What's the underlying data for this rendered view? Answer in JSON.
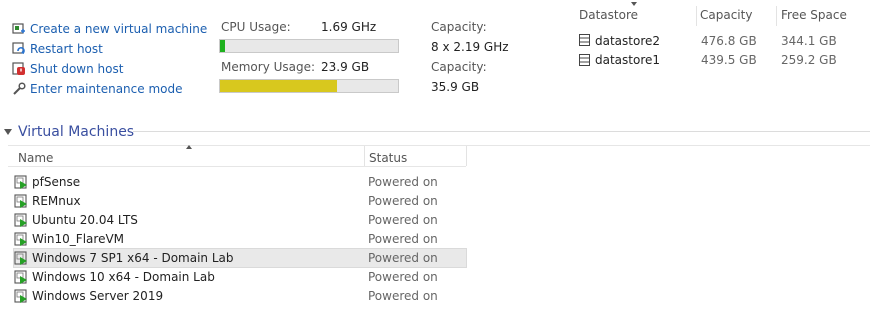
{
  "actions": [
    {
      "label": "Create a new virtual machine",
      "icon": "new-vm-icon"
    },
    {
      "label": "Restart host",
      "icon": "restart-icon"
    },
    {
      "label": "Shut down host",
      "icon": "shutdown-icon"
    },
    {
      "label": "Enter maintenance mode",
      "icon": "wrench-icon"
    }
  ],
  "usage": {
    "cpu_label": "CPU Usage:",
    "cpu_value": "1.69 GHz",
    "cpu_fraction": 0.03,
    "cpu_capacity_label": "Capacity:",
    "cpu_capacity_value": "8 x 2.19 GHz",
    "mem_label": "Memory Usage:",
    "mem_value": "23.9 GB",
    "mem_fraction": 0.66,
    "mem_capacity_label": "Capacity:",
    "mem_capacity_value": "35.9 GB",
    "cpu_color": "#1db11d",
    "mem_color": "#d8c81e"
  },
  "datastores": {
    "headers": [
      "Datastore",
      "Capacity",
      "Free Space"
    ],
    "rows": [
      {
        "name": "datastore2",
        "capacity": "476.8 GB",
        "free": "344.1 GB"
      },
      {
        "name": "datastore1",
        "capacity": "439.5 GB",
        "free": "259.2 GB"
      }
    ]
  },
  "vms": {
    "section_title": "Virtual Machines",
    "headers": {
      "name": "Name",
      "status": "Status"
    },
    "rows": [
      {
        "name": "pfSense",
        "status": "Powered on"
      },
      {
        "name": "REMnux",
        "status": "Powered on"
      },
      {
        "name": "Ubuntu 20.04 LTS",
        "status": "Powered on"
      },
      {
        "name": "Win10_FlareVM",
        "status": "Powered on"
      },
      {
        "name": "Windows 7 SP1 x64 - Domain Lab",
        "status": "Powered on",
        "selected": true
      },
      {
        "name": "Windows 10 x64 - Domain Lab",
        "status": "Powered on"
      },
      {
        "name": "Windows Server 2019",
        "status": "Powered on"
      }
    ]
  }
}
